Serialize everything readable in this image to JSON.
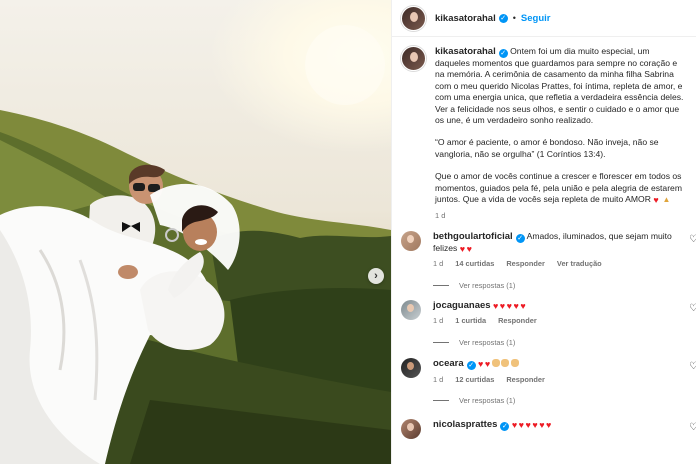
{
  "post": {
    "username": "kikasatorahal",
    "follow_label": "Seguir",
    "dot": "•",
    "caption_paragraphs": [
      "Ontem foi um dia muito especial, um daqueles momentos que guardamos para sempre no coração e na memória. A cerimônia de casamento da minha filha Sabrina com o meu querido Nicolas Prattes, foi íntima, repleta de amor, e com uma energia unica, que refletia a verdadeira essência deles. Ver a felicidade nos seus olhos, e sentir o cuidado e o amor que os une, é um verdadeiro sonho realizado.",
      "“O amor é paciente, o amor é bondoso. Não inveja, não se vangloria, não se orgulha” (1 Coríntios 13:4).",
      "Que o amor de vocês continue a crescer e florescer em todos os momentos, guiados pela fé, pela união e pela alegria de estarem juntos. Que a vida de vocês seja repleta de muito AMOR"
    ],
    "caption_time": "1 d",
    "caption_emojis": [
      "red-heart",
      "praying-hands"
    ]
  },
  "comments": [
    {
      "username": "bethgoulartoficial",
      "verified": true,
      "text": "Amados, iluminados, que sejam muito felizes",
      "emojis": [
        "red-heart",
        "red-heart"
      ],
      "time": "1 d",
      "likes": "14 curtidas",
      "reply_label": "Responder",
      "translate_label": "Ver tradução",
      "replies_label": "Ver respostas (1)"
    },
    {
      "username": "jocaguanaes",
      "verified": false,
      "text": "",
      "emojis": [
        "red-heart",
        "red-heart",
        "red-heart",
        "red-heart",
        "red-heart"
      ],
      "time": "1 d",
      "likes": "1 curtida",
      "reply_label": "Responder",
      "replies_label": "Ver respostas (1)"
    },
    {
      "username": "oceara",
      "verified": true,
      "text": "",
      "emojis": [
        "red-heart",
        "red-heart",
        "clapping-hands",
        "clapping-hands",
        "clapping-hands"
      ],
      "time": "1 d",
      "likes": "12 curtidas",
      "reply_label": "Responder",
      "replies_label": "Ver respostas (1)"
    },
    {
      "username": "nicolasprattes",
      "verified": true,
      "text": "",
      "emojis": [
        "red-heart",
        "red-heart",
        "red-heart",
        "red-heart",
        "red-heart",
        "red-heart"
      ]
    }
  ],
  "icons": {
    "next": "chevron-right-icon",
    "like": "heart-outline-icon",
    "verified": "verified-badge-icon"
  },
  "colors": {
    "link_blue": "#0095f6",
    "heart_red": "#ed1b24",
    "secondary_text": "#737373"
  }
}
